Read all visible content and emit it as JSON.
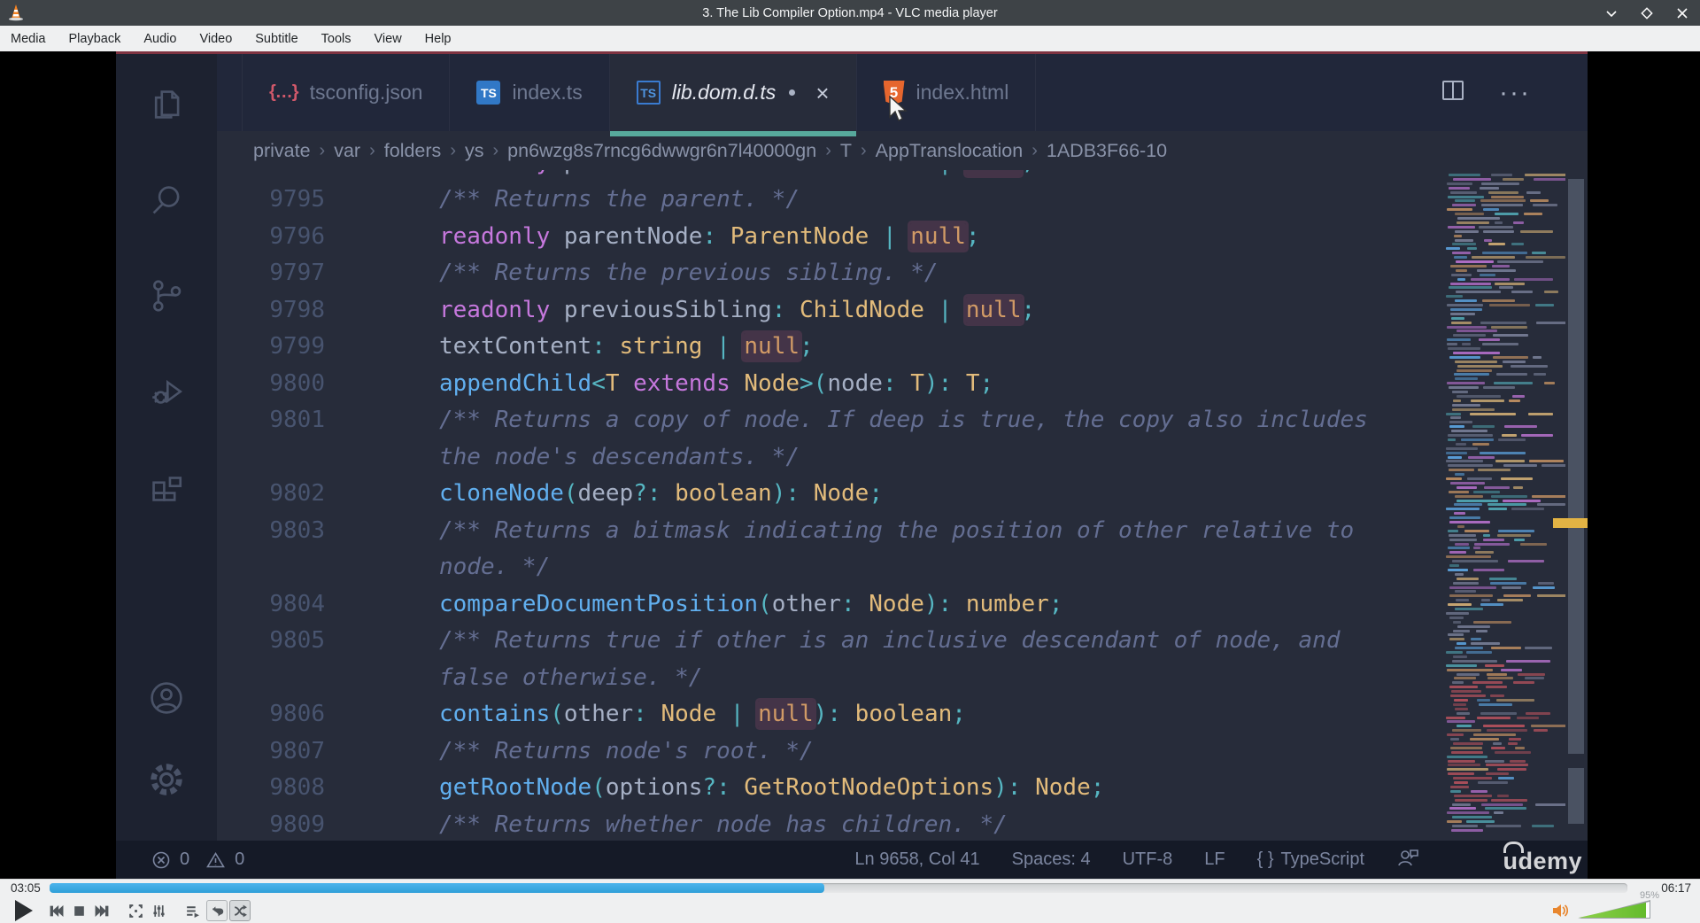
{
  "window": {
    "title": "3. The Lib Compiler Option.mp4 - VLC media player"
  },
  "menubar": {
    "items": [
      "Media",
      "Playback",
      "Audio",
      "Video",
      "Subtitle",
      "Tools",
      "View",
      "Help"
    ]
  },
  "vscode": {
    "tabs": [
      {
        "label": "tsconfig.json",
        "icon": "braces-icon",
        "active": false,
        "preview": false,
        "dirty": false
      },
      {
        "label": "index.ts",
        "icon": "ts-filled-icon",
        "active": false,
        "preview": false,
        "dirty": false
      },
      {
        "label": "lib.dom.d.ts",
        "icon": "ts-outline-icon",
        "active": true,
        "preview": true,
        "dirty": true,
        "close_label": "×"
      },
      {
        "label": "index.html",
        "icon": "html5-icon",
        "active": false,
        "preview": false,
        "dirty": false
      }
    ],
    "breadcrumb": [
      "private",
      "var",
      "folders",
      "ys",
      "pn6wzg8s7rncg6dwwgr6n7l40000gn",
      "T",
      "AppTranslocation",
      "1ADB3F66-10"
    ],
    "editor": {
      "partial_line": {
        "number": "",
        "tokens": [
          [
            "keyword",
            "readonly"
          ],
          [
            "plain",
            " "
          ],
          [
            "prop",
            "parentElement"
          ],
          [
            "punct",
            ":"
          ],
          [
            "plain",
            " "
          ],
          [
            "type",
            "HTMLElement"
          ],
          [
            "plain",
            " "
          ],
          [
            "punct",
            "|"
          ],
          [
            "plain",
            " "
          ],
          [
            "nullhl",
            "null"
          ],
          [
            "punct",
            ";"
          ]
        ]
      },
      "rows": [
        {
          "number": "9795",
          "tokens": [
            [
              "comment",
              "/** Returns the parent. */"
            ]
          ]
        },
        {
          "number": "9796",
          "tokens": [
            [
              "keyword",
              "readonly"
            ],
            [
              "plain",
              " "
            ],
            [
              "prop",
              "parentNode"
            ],
            [
              "punct",
              ":"
            ],
            [
              "plain",
              " "
            ],
            [
              "type",
              "ParentNode"
            ],
            [
              "plain",
              " "
            ],
            [
              "punct",
              "|"
            ],
            [
              "plain",
              " "
            ],
            [
              "nullhl",
              "null"
            ],
            [
              "punct",
              ";"
            ]
          ]
        },
        {
          "number": "9797",
          "tokens": [
            [
              "comment",
              "/** Returns the previous sibling. */"
            ]
          ]
        },
        {
          "number": "9798",
          "tokens": [
            [
              "keyword",
              "readonly"
            ],
            [
              "plain",
              " "
            ],
            [
              "prop",
              "previousSibling"
            ],
            [
              "punct",
              ":"
            ],
            [
              "plain",
              " "
            ],
            [
              "type",
              "ChildNode"
            ],
            [
              "plain",
              " "
            ],
            [
              "punct",
              "|"
            ],
            [
              "plain",
              " "
            ],
            [
              "nullhl",
              "null"
            ],
            [
              "punct",
              ";"
            ]
          ]
        },
        {
          "number": "9799",
          "tokens": [
            [
              "prop",
              "textContent"
            ],
            [
              "punct",
              ":"
            ],
            [
              "plain",
              " "
            ],
            [
              "type",
              "string"
            ],
            [
              "plain",
              " "
            ],
            [
              "punct",
              "|"
            ],
            [
              "plain",
              " "
            ],
            [
              "nullhl",
              "null"
            ],
            [
              "punct",
              ";"
            ]
          ]
        },
        {
          "number": "9800",
          "tokens": [
            [
              "method",
              "appendChild"
            ],
            [
              "punct",
              "<"
            ],
            [
              "type",
              "T"
            ],
            [
              "plain",
              " "
            ],
            [
              "keyword",
              "extends"
            ],
            [
              "plain",
              " "
            ],
            [
              "type",
              "Node"
            ],
            [
              "punct",
              ">("
            ],
            [
              "prop",
              "node"
            ],
            [
              "punct",
              ":"
            ],
            [
              "plain",
              " "
            ],
            [
              "type",
              "T"
            ],
            [
              "punct",
              "):"
            ],
            [
              "plain",
              " "
            ],
            [
              "type",
              "T"
            ],
            [
              "punct",
              ";"
            ]
          ]
        },
        {
          "number": "9801",
          "tokens": [
            [
              "comment",
              "/** Returns a copy of node. If deep is true, the copy also includes"
            ]
          ]
        },
        {
          "number": "",
          "tokens": [
            [
              "comment",
              "the node's descendants. */"
            ]
          ]
        },
        {
          "number": "9802",
          "tokens": [
            [
              "method",
              "cloneNode"
            ],
            [
              "punct",
              "("
            ],
            [
              "prop",
              "deep"
            ],
            [
              "punct",
              "?:"
            ],
            [
              "plain",
              " "
            ],
            [
              "type",
              "boolean"
            ],
            [
              "punct",
              "):"
            ],
            [
              "plain",
              " "
            ],
            [
              "type",
              "Node"
            ],
            [
              "punct",
              ";"
            ]
          ]
        },
        {
          "number": "9803",
          "tokens": [
            [
              "comment",
              "/** Returns a bitmask indicating the position of other relative to"
            ]
          ]
        },
        {
          "number": "",
          "tokens": [
            [
              "comment",
              "node. */"
            ]
          ]
        },
        {
          "number": "9804",
          "tokens": [
            [
              "method",
              "compareDocumentPosition"
            ],
            [
              "punct",
              "("
            ],
            [
              "prop",
              "other"
            ],
            [
              "punct",
              ":"
            ],
            [
              "plain",
              " "
            ],
            [
              "type",
              "Node"
            ],
            [
              "punct",
              "):"
            ],
            [
              "plain",
              " "
            ],
            [
              "type",
              "number"
            ],
            [
              "punct",
              ";"
            ]
          ]
        },
        {
          "number": "9805",
          "tokens": [
            [
              "comment",
              "/** Returns true if other is an inclusive descendant of node, and"
            ]
          ]
        },
        {
          "number": "",
          "tokens": [
            [
              "comment",
              "false otherwise. */"
            ]
          ]
        },
        {
          "number": "9806",
          "tokens": [
            [
              "method",
              "contains"
            ],
            [
              "punct",
              "("
            ],
            [
              "prop",
              "other"
            ],
            [
              "punct",
              ":"
            ],
            [
              "plain",
              " "
            ],
            [
              "type",
              "Node"
            ],
            [
              "plain",
              " "
            ],
            [
              "punct",
              "|"
            ],
            [
              "plain",
              " "
            ],
            [
              "nullhl",
              "null"
            ],
            [
              "punct",
              "):"
            ],
            [
              "plain",
              " "
            ],
            [
              "type",
              "boolean"
            ],
            [
              "punct",
              ";"
            ]
          ]
        },
        {
          "number": "9807",
          "tokens": [
            [
              "comment",
              "/** Returns node's root. */"
            ]
          ]
        },
        {
          "number": "9808",
          "tokens": [
            [
              "method",
              "getRootNode"
            ],
            [
              "punct",
              "("
            ],
            [
              "prop",
              "options"
            ],
            [
              "punct",
              "?:"
            ],
            [
              "plain",
              " "
            ],
            [
              "type",
              "GetRootNodeOptions"
            ],
            [
              "punct",
              "):"
            ],
            [
              "plain",
              " "
            ],
            [
              "type",
              "Node"
            ],
            [
              "punct",
              ";"
            ]
          ]
        },
        {
          "number": "9809",
          "tokens": [
            [
              "comment",
              "/** Returns whether node has children. */"
            ]
          ]
        }
      ]
    },
    "status": {
      "errors": "0",
      "warnings": "0",
      "cursor_position": "Ln 9658, Col 41",
      "indentation": "Spaces: 4",
      "encoding": "UTF-8",
      "eol": "LF",
      "language_braces": "{ }",
      "language": "TypeScript"
    },
    "watermark": "udemy"
  },
  "player": {
    "elapsed": "03:05",
    "duration": "06:17",
    "progress_percent": 49.1,
    "volume_label": "95%",
    "volume_fill_percent": 95
  },
  "colors": {
    "vlc_accent_blue": "#3daee9",
    "volume_green": "#64bb2c",
    "tab_underline_teal": "#57a99c",
    "ts_icon_blue": "#3178c6",
    "html_icon_orange": "#e6662e",
    "minimap_marker_yellow": "#e2b344",
    "word_highlight": "#443448",
    "editor_background": "#272c3a"
  }
}
